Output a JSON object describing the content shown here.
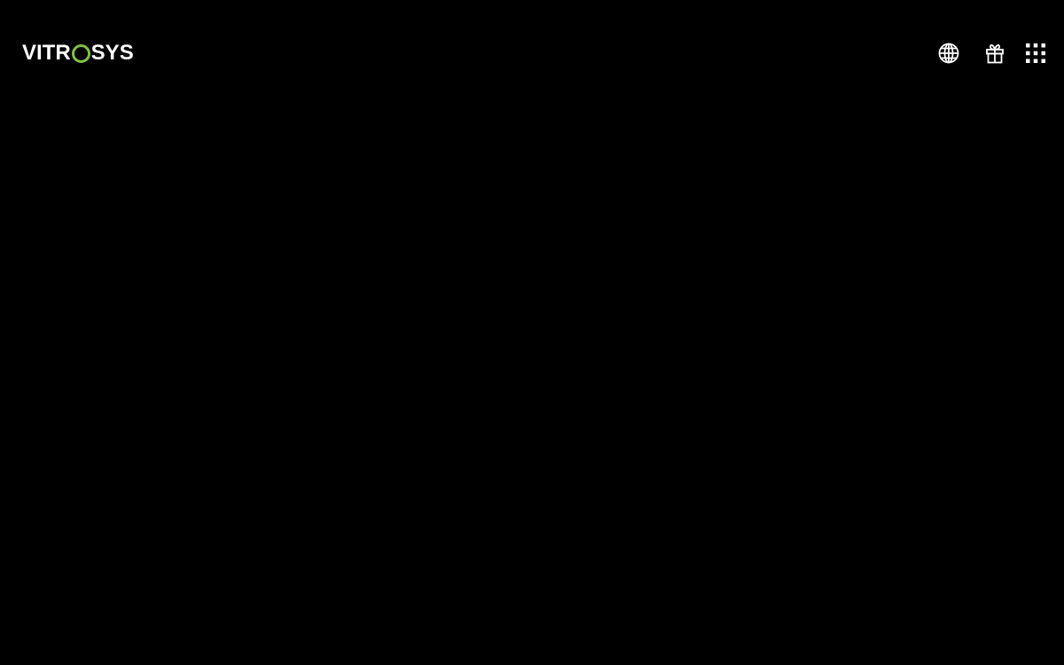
{
  "header": {
    "logo": {
      "text_before": "VITR",
      "ring_letter": "O",
      "text_after": "SYS",
      "ring_color": "#7fc241",
      "text_color": "#ffffff"
    },
    "icons": [
      {
        "name": "globe-icon"
      },
      {
        "name": "gift-icon"
      },
      {
        "name": "apps-grid-icon"
      }
    ]
  },
  "colors": {
    "background": "#000000",
    "icon": "#ffffff"
  }
}
